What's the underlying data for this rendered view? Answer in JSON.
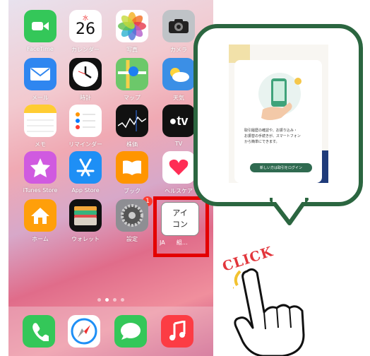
{
  "apps": [
    {
      "label": "FaceTime",
      "icon": "facetime-icon",
      "bg": "#34c759"
    },
    {
      "label": "カレンダー",
      "icon": "calendar-icon",
      "bg": "#ffffff",
      "day": "水",
      "date": "26"
    },
    {
      "label": "写真",
      "icon": "photos-icon",
      "bg": "#ffffff"
    },
    {
      "label": "カメラ",
      "icon": "camera-icon",
      "bg": "#bfc3c7"
    },
    {
      "label": "メール",
      "icon": "mail-icon",
      "bg": "#2f86f0"
    },
    {
      "label": "時計",
      "icon": "clock-icon",
      "bg": "#111111"
    },
    {
      "label": "マップ",
      "icon": "maps-icon",
      "bg": "#6cc86a"
    },
    {
      "label": "天気",
      "icon": "weather-icon",
      "bg": "#3b8fe6"
    },
    {
      "label": "メモ",
      "icon": "notes-icon",
      "bg": "#ffffff"
    },
    {
      "label": "リマインダー",
      "icon": "reminders-icon",
      "bg": "#ffffff"
    },
    {
      "label": "株価",
      "icon": "stocks-icon",
      "bg": "#111111"
    },
    {
      "label": "TV",
      "icon": "appletv-icon",
      "bg": "#111111",
      "text": "tv"
    },
    {
      "label": "iTunes Store",
      "icon": "itunes-store-icon",
      "bg": "#d05ae0"
    },
    {
      "label": "App Store",
      "icon": "app-store-icon",
      "bg": "#1e8ff5"
    },
    {
      "label": "ブック",
      "icon": "books-icon",
      "bg": "#ff9500"
    },
    {
      "label": "ヘルスケア",
      "icon": "health-icon",
      "bg": "#ffffff"
    },
    {
      "label": "ホーム",
      "icon": "home-icon",
      "bg": "#ff9f0a"
    },
    {
      "label": "ウォレット",
      "icon": "wallet-icon",
      "bg": "#111111"
    },
    {
      "label": "設定",
      "icon": "settings-icon",
      "bg": "#8e8e93",
      "badge": "1"
    }
  ],
  "ja_app": {
    "icon_text": "アイ\nコン",
    "label": "JA　　組…"
  },
  "dock": [
    {
      "icon": "phone-icon",
      "bg": "#34c759"
    },
    {
      "icon": "safari-icon",
      "bg": "#ffffff"
    },
    {
      "icon": "messages-icon",
      "bg": "#34c759"
    },
    {
      "icon": "music-icon",
      "bg": "#fc3c44"
    }
  ],
  "bubble": {
    "text_lines": [
      "取引履歴の確認や、お振り込み・",
      "お振替の手続きが、スマートフォン",
      "から簡単にできます。"
    ],
    "login_button": "新しい方は取引をログイン"
  },
  "click_text": "CLICK",
  "colors": {
    "highlight": "#e40000",
    "bubble_border": "#2b6640",
    "click": "#e2353b"
  }
}
